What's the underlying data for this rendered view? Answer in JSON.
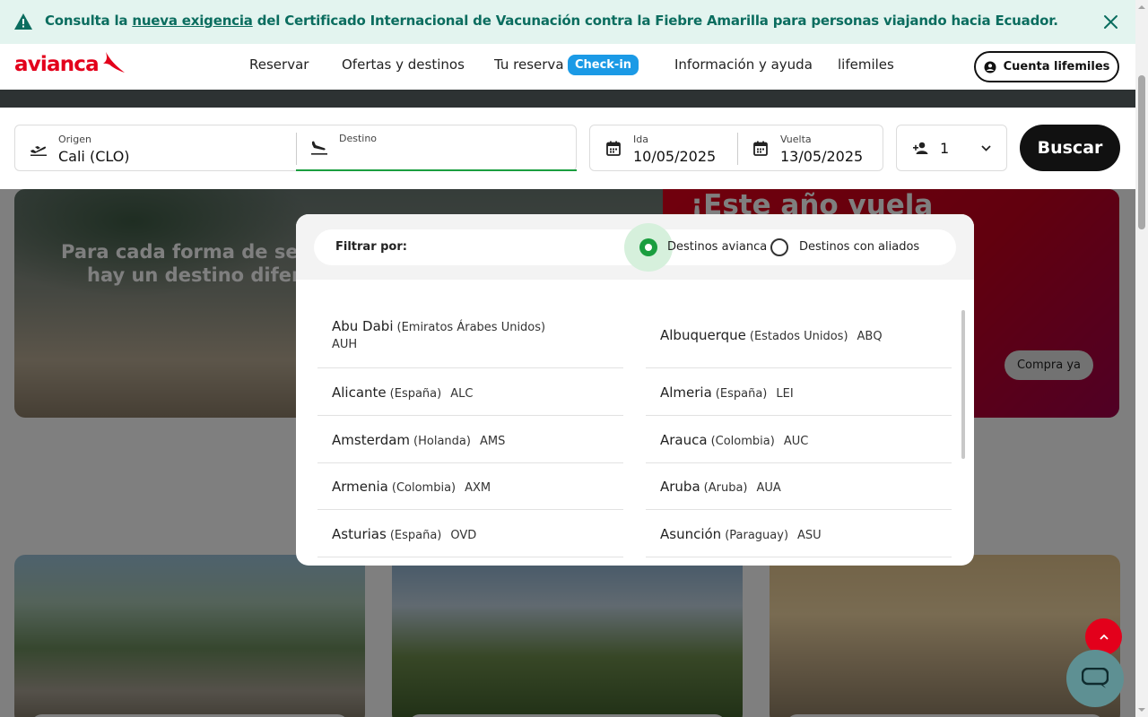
{
  "alert": {
    "text_before": "Consulta la ",
    "link": "nueva exigencia",
    "text_after": " del Certificado Internacional de Vacunación contra la Fiebre Amarilla para personas viajando hacia Ecuador.",
    "icon": "warning-icon",
    "close_icon": "close-icon",
    "color": "#0b6d5f"
  },
  "header": {
    "logo": "avianca",
    "nav": [
      "Reservar",
      "Ofertas y destinos",
      "Tu reserva",
      "Información y ayuda",
      "lifemiles"
    ],
    "checkin_badge": "Check-in",
    "account_button": "Cuenta lifemiles",
    "brand_color": "#e3001b"
  },
  "search": {
    "origin": {
      "label": "Origen",
      "value": "Cali  (CLO)",
      "icon": "plane-takeoff-icon"
    },
    "destination": {
      "label": "Destino",
      "value": "",
      "icon": "plane-landing-icon"
    },
    "departure": {
      "label": "Ida",
      "value": "10/05/2025",
      "icon": "calendar-icon"
    },
    "return": {
      "label": "Vuelta",
      "value": "13/05/2025",
      "icon": "calendar-icon"
    },
    "passengers": {
      "value": "1",
      "icon": "add-person-icon"
    },
    "search_button": "Buscar"
  },
  "dropdown": {
    "filter_label": "Filtrar por:",
    "options": [
      "Destinos avianca",
      "Destinos con aliados"
    ],
    "selected": "Destinos avianca",
    "destinations": [
      {
        "city": "Abu Dabi",
        "country": "(Emiratos Árabes Unidos)",
        "code": "AUH"
      },
      {
        "city": "Albuquerque",
        "country": "(Estados Unidos)",
        "code": "ABQ"
      },
      {
        "city": "Alicante",
        "country": "(España)",
        "code": "ALC"
      },
      {
        "city": "Almeria",
        "country": "(España)",
        "code": "LEI"
      },
      {
        "city": "Amsterdam",
        "country": "(Holanda)",
        "code": "AMS"
      },
      {
        "city": "Arauca",
        "country": "(Colombia)",
        "code": "AUC"
      },
      {
        "city": "Armenia",
        "country": "(Colombia)",
        "code": "AXM"
      },
      {
        "city": "Aruba",
        "country": "(Aruba)",
        "code": "AUA"
      },
      {
        "city": "Asturias",
        "country": "(España)",
        "code": "OVD"
      },
      {
        "city": "Asunción",
        "country": "(Paraguay)",
        "code": "ASU"
      }
    ]
  },
  "background": {
    "hero_text_1": "Para cada forma de ser",
    "hero_text_2": "hay un destino difere",
    "hero_red_title": "¡Este año vuela",
    "hero_button": "Compra ya"
  },
  "floating": {
    "scroll_top_icon": "chevron-up-icon",
    "chat_icon": "chat-icon"
  }
}
